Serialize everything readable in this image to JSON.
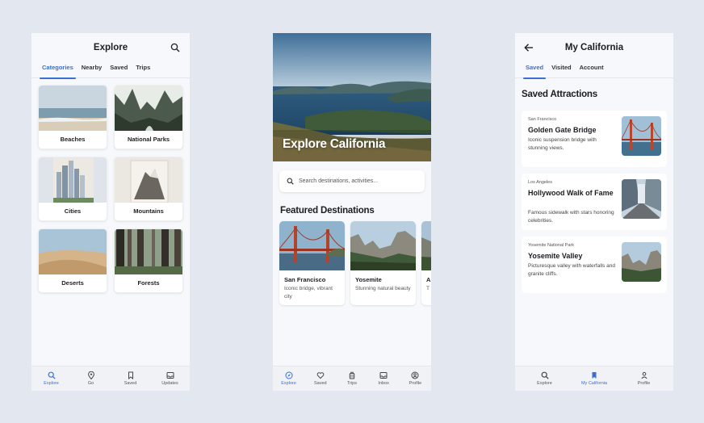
{
  "explore": {
    "title": "Explore",
    "tabs": [
      "Categories",
      "Nearby",
      "Saved",
      "Trips"
    ],
    "categories": [
      "Beaches",
      "National Parks",
      "Cities",
      "Mountains",
      "Deserts",
      "Forests"
    ],
    "nav": [
      "Explore",
      "Go",
      "Saved",
      "Updates"
    ]
  },
  "home": {
    "hero_title": "Explore California",
    "search_placeholder": "Search destinations, activities...",
    "section_title": "Featured Destinations",
    "destinations": [
      {
        "name": "San Francisco",
        "desc": "Iconic bridge, vibrant city"
      },
      {
        "name": "Yosemite",
        "desc": "Stunning natural beauty"
      },
      {
        "name": "A",
        "desc": "T"
      }
    ],
    "nav": [
      "Explore",
      "Saved",
      "Trips",
      "Inbox",
      "Profile"
    ]
  },
  "mycal": {
    "title": "My California",
    "tabs": [
      "Saved",
      "Visited",
      "Account"
    ],
    "section_title": "Saved Attractions",
    "attractions": [
      {
        "location": "San Francisco",
        "name": "Golden Gate Bridge",
        "desc": "Iconic suspension bridge with stunning views."
      },
      {
        "location": "Los Angeles",
        "name": "Hollywood Walk of Fame",
        "desc": "Famous sidewalk with stars honoring celebrities."
      },
      {
        "location": "Yosemite National Park",
        "name": "Yosemite Valley",
        "desc": "Picturesque valley with waterfalls and granite cliffs."
      }
    ],
    "nav": [
      "Explore",
      "My California",
      "Profile"
    ]
  },
  "colors": {
    "accent": "#3a6fd6",
    "background": "#e3e7ef",
    "screen": "#f6f8fb"
  }
}
